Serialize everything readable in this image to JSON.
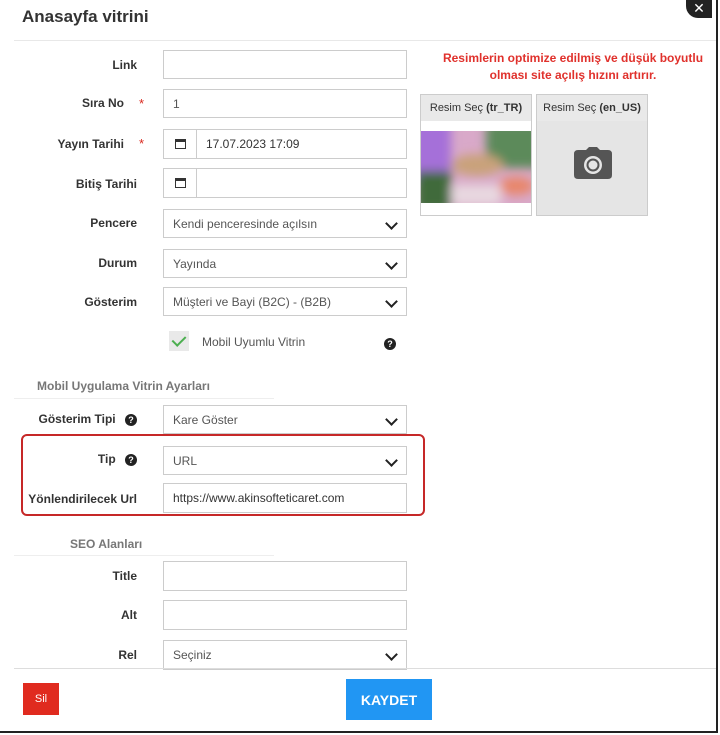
{
  "modal": {
    "title": "Anasayfa vitrini",
    "close": "✕"
  },
  "form": {
    "link": {
      "label": "Link",
      "value": ""
    },
    "sira_no": {
      "label": "Sıra No",
      "value": "1",
      "required": "*"
    },
    "yayin_tarihi": {
      "label": "Yayın Tarihi",
      "value": "17.07.2023 17:09",
      "required": "*"
    },
    "bitis_tarihi": {
      "label": "Bitiş Tarihi",
      "value": ""
    },
    "pencere": {
      "label": "Pencere",
      "value": "Kendi penceresinde açılsın"
    },
    "durum": {
      "label": "Durum",
      "value": "Yayında"
    },
    "gosterim": {
      "label": "Gösterim",
      "value": "Müşteri ve Bayi (B2C) - (B2B)"
    },
    "mobil": {
      "label": "Mobil Uyumlu Vitrin",
      "checked": true
    }
  },
  "mobile_section": {
    "title": "Mobil Uygulama Vitrin Ayarları",
    "gosterim_tipi": {
      "label": "Gösterim Tipi",
      "value": "Kare Göster"
    },
    "tip": {
      "label": "Tip",
      "value": "URL"
    },
    "url": {
      "label": "Yönlendirilecek Url",
      "value": "https://www.akinsofteticaret.com"
    }
  },
  "seo_section": {
    "title": "SEO Alanları",
    "title_field": {
      "label": "Title",
      "value": ""
    },
    "alt_field": {
      "label": "Alt",
      "value": ""
    },
    "rel_field": {
      "label": "Rel",
      "value": "Seçiniz"
    }
  },
  "images": {
    "notice": "Resimlerin optimize edilmiş ve düşük boyutlu olması site açılış hızını artırır.",
    "cards": [
      {
        "prefix": "Resim Seç",
        "lang": "(tr_TR)"
      },
      {
        "prefix": "Resim Seç",
        "lang": "(en_US)"
      }
    ]
  },
  "footer": {
    "delete": "Sil",
    "save": "KAYDET"
  },
  "colors": {
    "primary": "#2196f3",
    "danger": "#e02b1f",
    "highlight": "#c62828",
    "notice": "#e0312c"
  }
}
